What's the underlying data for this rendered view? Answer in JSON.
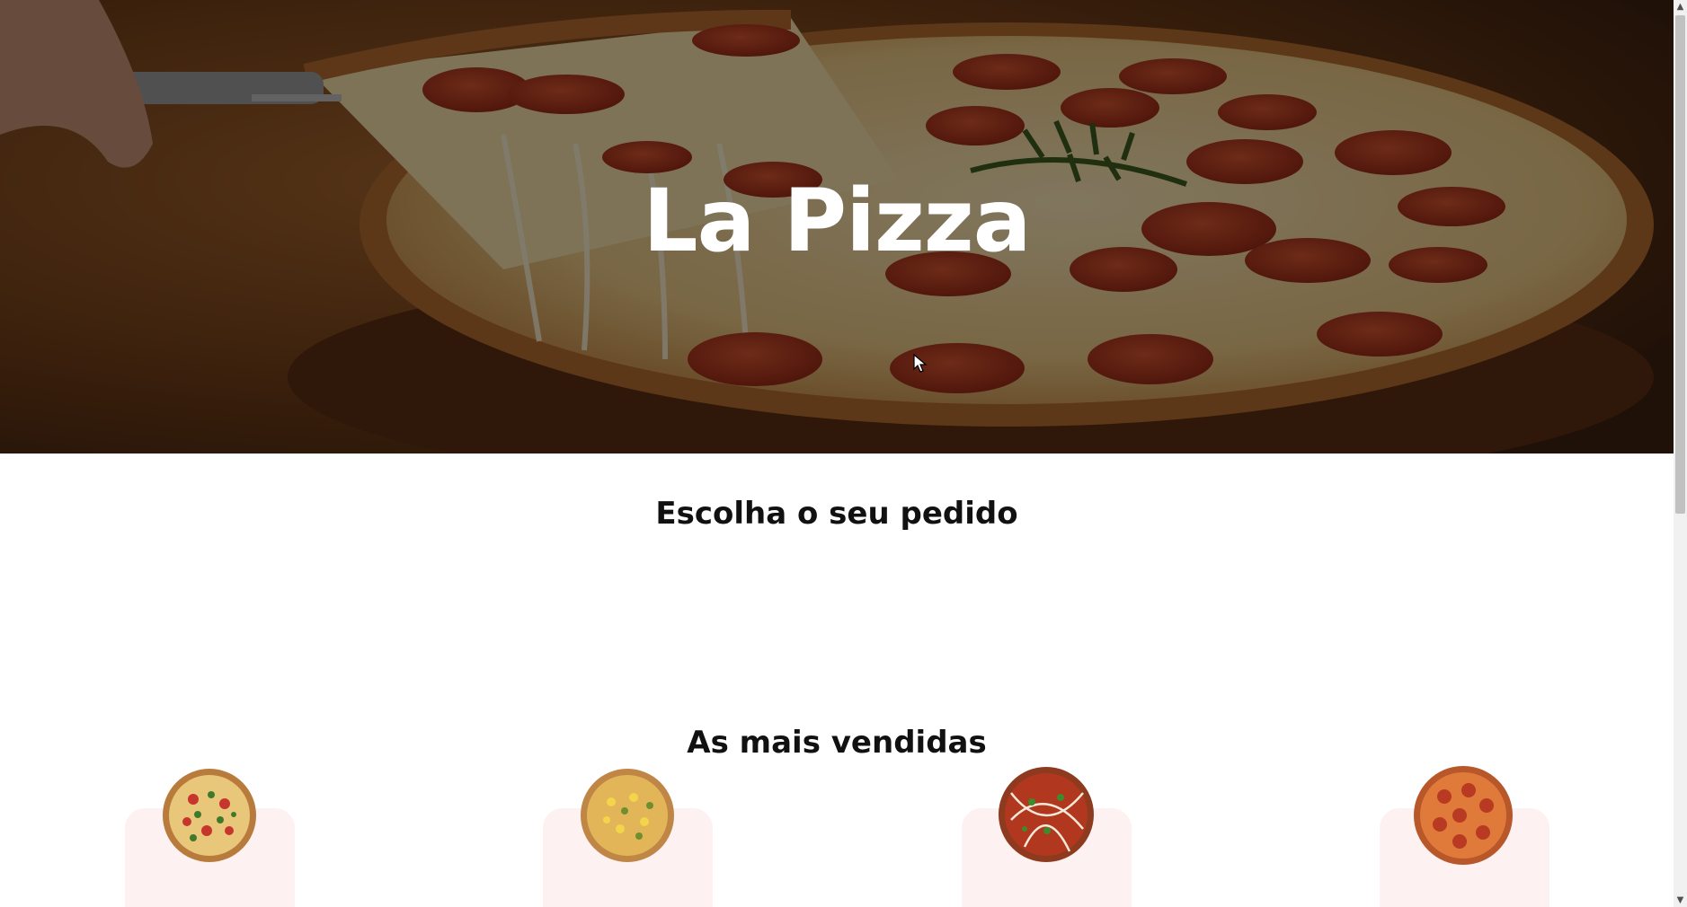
{
  "hero": {
    "title": "La Pizza",
    "image_icon": "pepperoni-pizza-photo"
  },
  "sections": {
    "choose_title": "Escolha o seu pedido",
    "best_sellers_title": "As mais vendidas"
  },
  "best_sellers": [
    {
      "icon": "veggie-pizza-icon"
    },
    {
      "icon": "corn-pizza-icon"
    },
    {
      "icon": "bbq-pizza-icon"
    },
    {
      "icon": "pepperoni-pizza-icon"
    }
  ],
  "colors": {
    "card_bg": "#fdf2f1",
    "hero_overlay": "#000000",
    "title_text": "#ffffff",
    "heading_text": "#111111"
  }
}
